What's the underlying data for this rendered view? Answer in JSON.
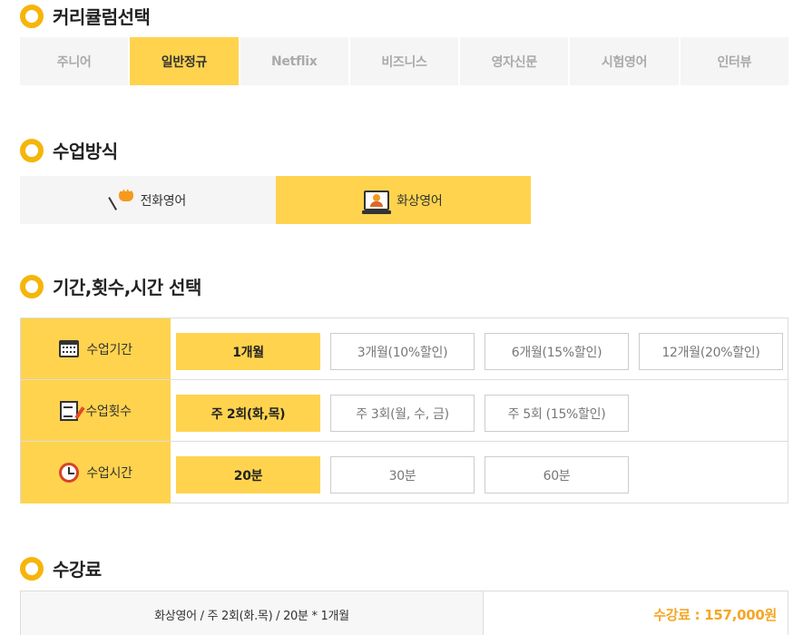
{
  "sections": {
    "curriculum": "커리큘럼선택",
    "method": "수업방식",
    "options": "기간,횟수,시간 선택",
    "fee": "수강료"
  },
  "curriculum_tabs": [
    {
      "label": "주니어",
      "active": false
    },
    {
      "label": "일반정규",
      "active": true
    },
    {
      "label": "Netflix",
      "active": false
    },
    {
      "label": "비즈니스",
      "active": false
    },
    {
      "label": "영자신문",
      "active": false
    },
    {
      "label": "시험영어",
      "active": false
    },
    {
      "label": "인터뷰",
      "active": false
    }
  ],
  "methods": [
    {
      "label": "전화영어",
      "icon": "phone-chat-icon",
      "active": false
    },
    {
      "label": "화상영어",
      "icon": "video-call-icon",
      "active": true
    }
  ],
  "options": {
    "period": {
      "label": "수업기간",
      "icon": "calendar-icon",
      "choices": [
        "1개월",
        "3개월(10%할인)",
        "6개월(15%할인)",
        "12개월(20%할인)"
      ],
      "selected": 0
    },
    "frequency": {
      "label": "수업횟수",
      "icon": "note-pencil-icon",
      "choices": [
        "주 2회(화,목)",
        "주 3회(월, 수, 금)",
        "주 5회 (15%할인)"
      ],
      "selected": 0
    },
    "duration": {
      "label": "수업시간",
      "icon": "clock-icon",
      "choices": [
        "20분",
        "30분",
        "60분"
      ],
      "selected": 0
    }
  },
  "fee": {
    "summary": "화상영어 / 주 2회(화.목) / 20분 * 1개월",
    "price": "수강료 : 157,000원"
  },
  "colors": {
    "accent": "#ffd34e",
    "ring": "#f5b50a",
    "price": "#f5a623"
  }
}
